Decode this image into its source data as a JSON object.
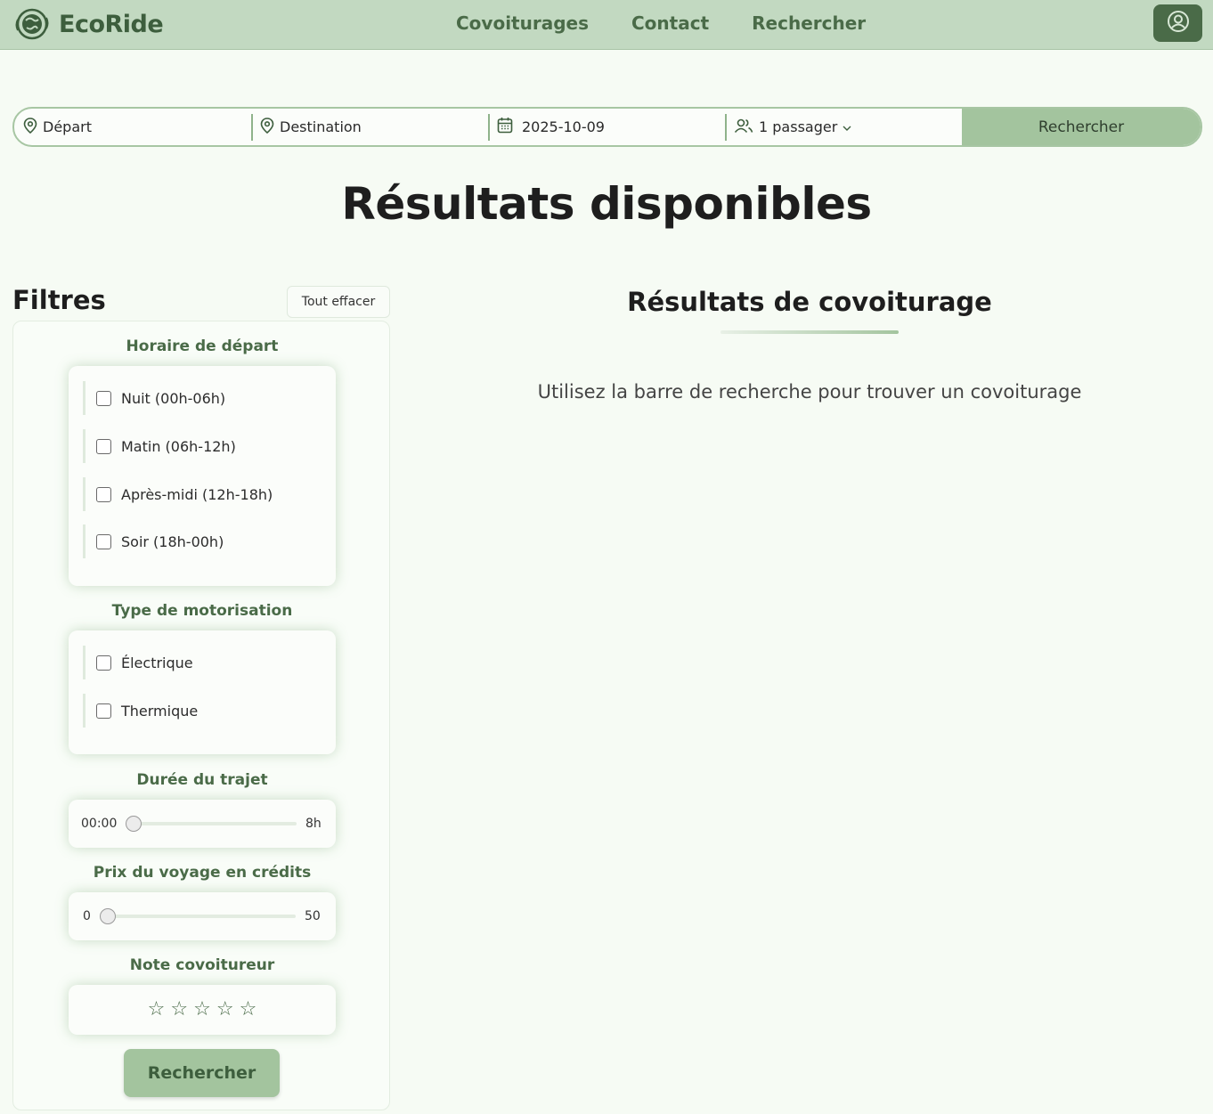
{
  "header": {
    "brand": "EcoRide",
    "nav": [
      "Covoiturages",
      "Contact",
      "Rechercher"
    ]
  },
  "search": {
    "departure_placeholder": "Départ",
    "destination_placeholder": "Destination",
    "date": "2025-10-09",
    "passengers": "1 passager",
    "button": "Rechercher"
  },
  "page_title": "Résultats disponibles",
  "filters": {
    "heading": "Filtres",
    "clear_all": "Tout effacer",
    "departure_time": {
      "title": "Horaire de départ",
      "options": [
        "Nuit (00h-06h)",
        "Matin (06h-12h)",
        "Après-midi (12h-18h)",
        "Soir (18h-00h)"
      ]
    },
    "engine_type": {
      "title": "Type de motorisation",
      "options": [
        "Électrique",
        "Thermique"
      ]
    },
    "duration": {
      "title": "Durée du trajet",
      "current": "00:00",
      "max": "8h",
      "value": 0
    },
    "price": {
      "title": "Prix du voyage en crédits",
      "current": "0",
      "max": "50",
      "value": 0
    },
    "rating": {
      "title": "Note covoitureur",
      "stars_filled": 0,
      "stars_total": 5
    },
    "search_button": "Rechercher"
  },
  "results": {
    "title": "Résultats de covoiturage",
    "empty_message": "Utilisez la barre de recherche pour trouver un covoiturage"
  },
  "colors": {
    "header_bg": "#c2d9c1",
    "accent": "#a3c49e",
    "accent_dark": "#4a6b48",
    "page_bg": "#f6fbf4"
  }
}
